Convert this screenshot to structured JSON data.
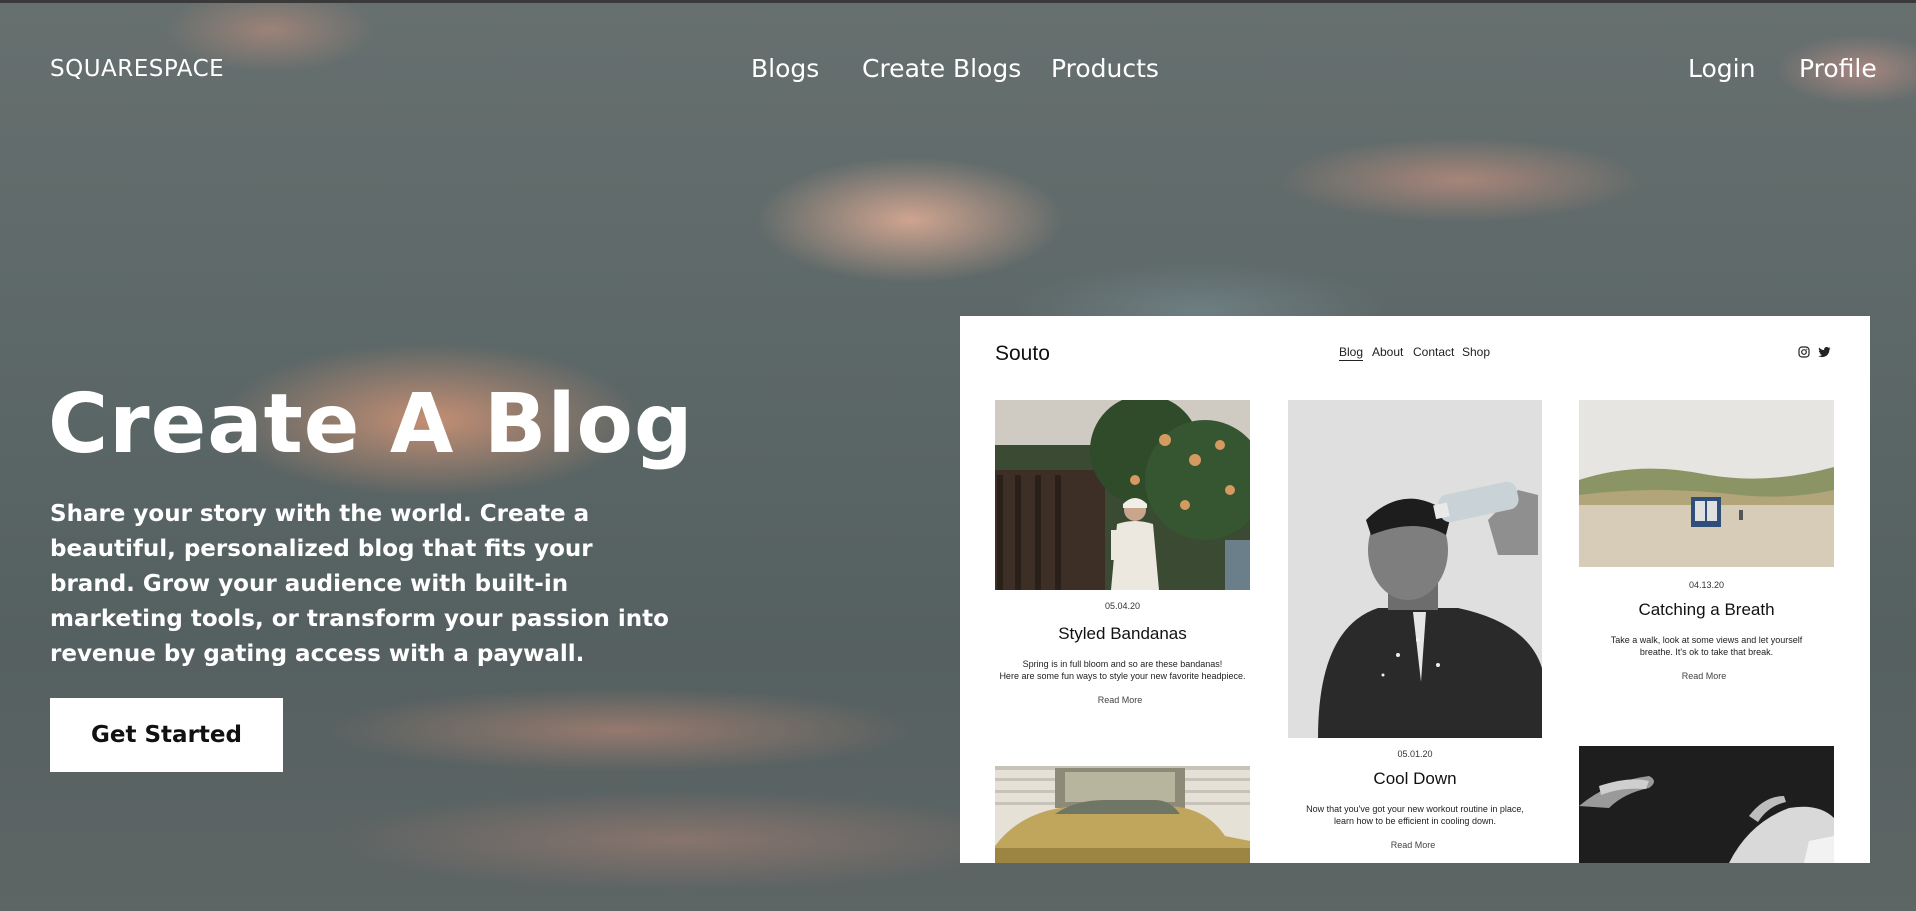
{
  "brand": "SQUARESPACE",
  "nav": {
    "blogs": "Blogs",
    "create_blogs": "Create Blogs",
    "products": "Products",
    "login": "Login",
    "profile": "Profile"
  },
  "hero": {
    "title": "Create A Blog",
    "description": "Share your story with the world. Create a beautiful, personalized blog that fits your brand. Grow your audience with built-in marketing tools, or transform your passion into revenue by gating access with a paywall.",
    "cta": "Get Started"
  },
  "preview": {
    "site_name": "Souto",
    "nav": [
      "Blog",
      "About",
      "Contact",
      "Shop"
    ],
    "social_icons": [
      "instagram-icon",
      "twitter-icon"
    ],
    "posts": [
      {
        "date": "05.04.20",
        "title": "Styled Bandanas",
        "excerpt_1": "Spring is in full bloom and so are these bandanas!",
        "excerpt_2": "Here are some fun ways to style your new favorite headpiece.",
        "read_more": "Read More"
      },
      {
        "date": "05.01.20",
        "title": "Cool Down",
        "excerpt_1": "Now that you've got your new workout routine in place,",
        "excerpt_2": "learn how to be efficient in cooling down.",
        "read_more": "Read More"
      },
      {
        "date": "04.13.20",
        "title": "Catching a Breath",
        "excerpt_1": "Take a walk, look at some views and let yourself",
        "excerpt_2": "breathe. It's ok to take that break.",
        "read_more": "Read More"
      }
    ]
  },
  "colors": {
    "background": "#596364",
    "accent_glow": "#d49a80",
    "cta_bg": "#ffffff",
    "text": "#ffffff"
  }
}
